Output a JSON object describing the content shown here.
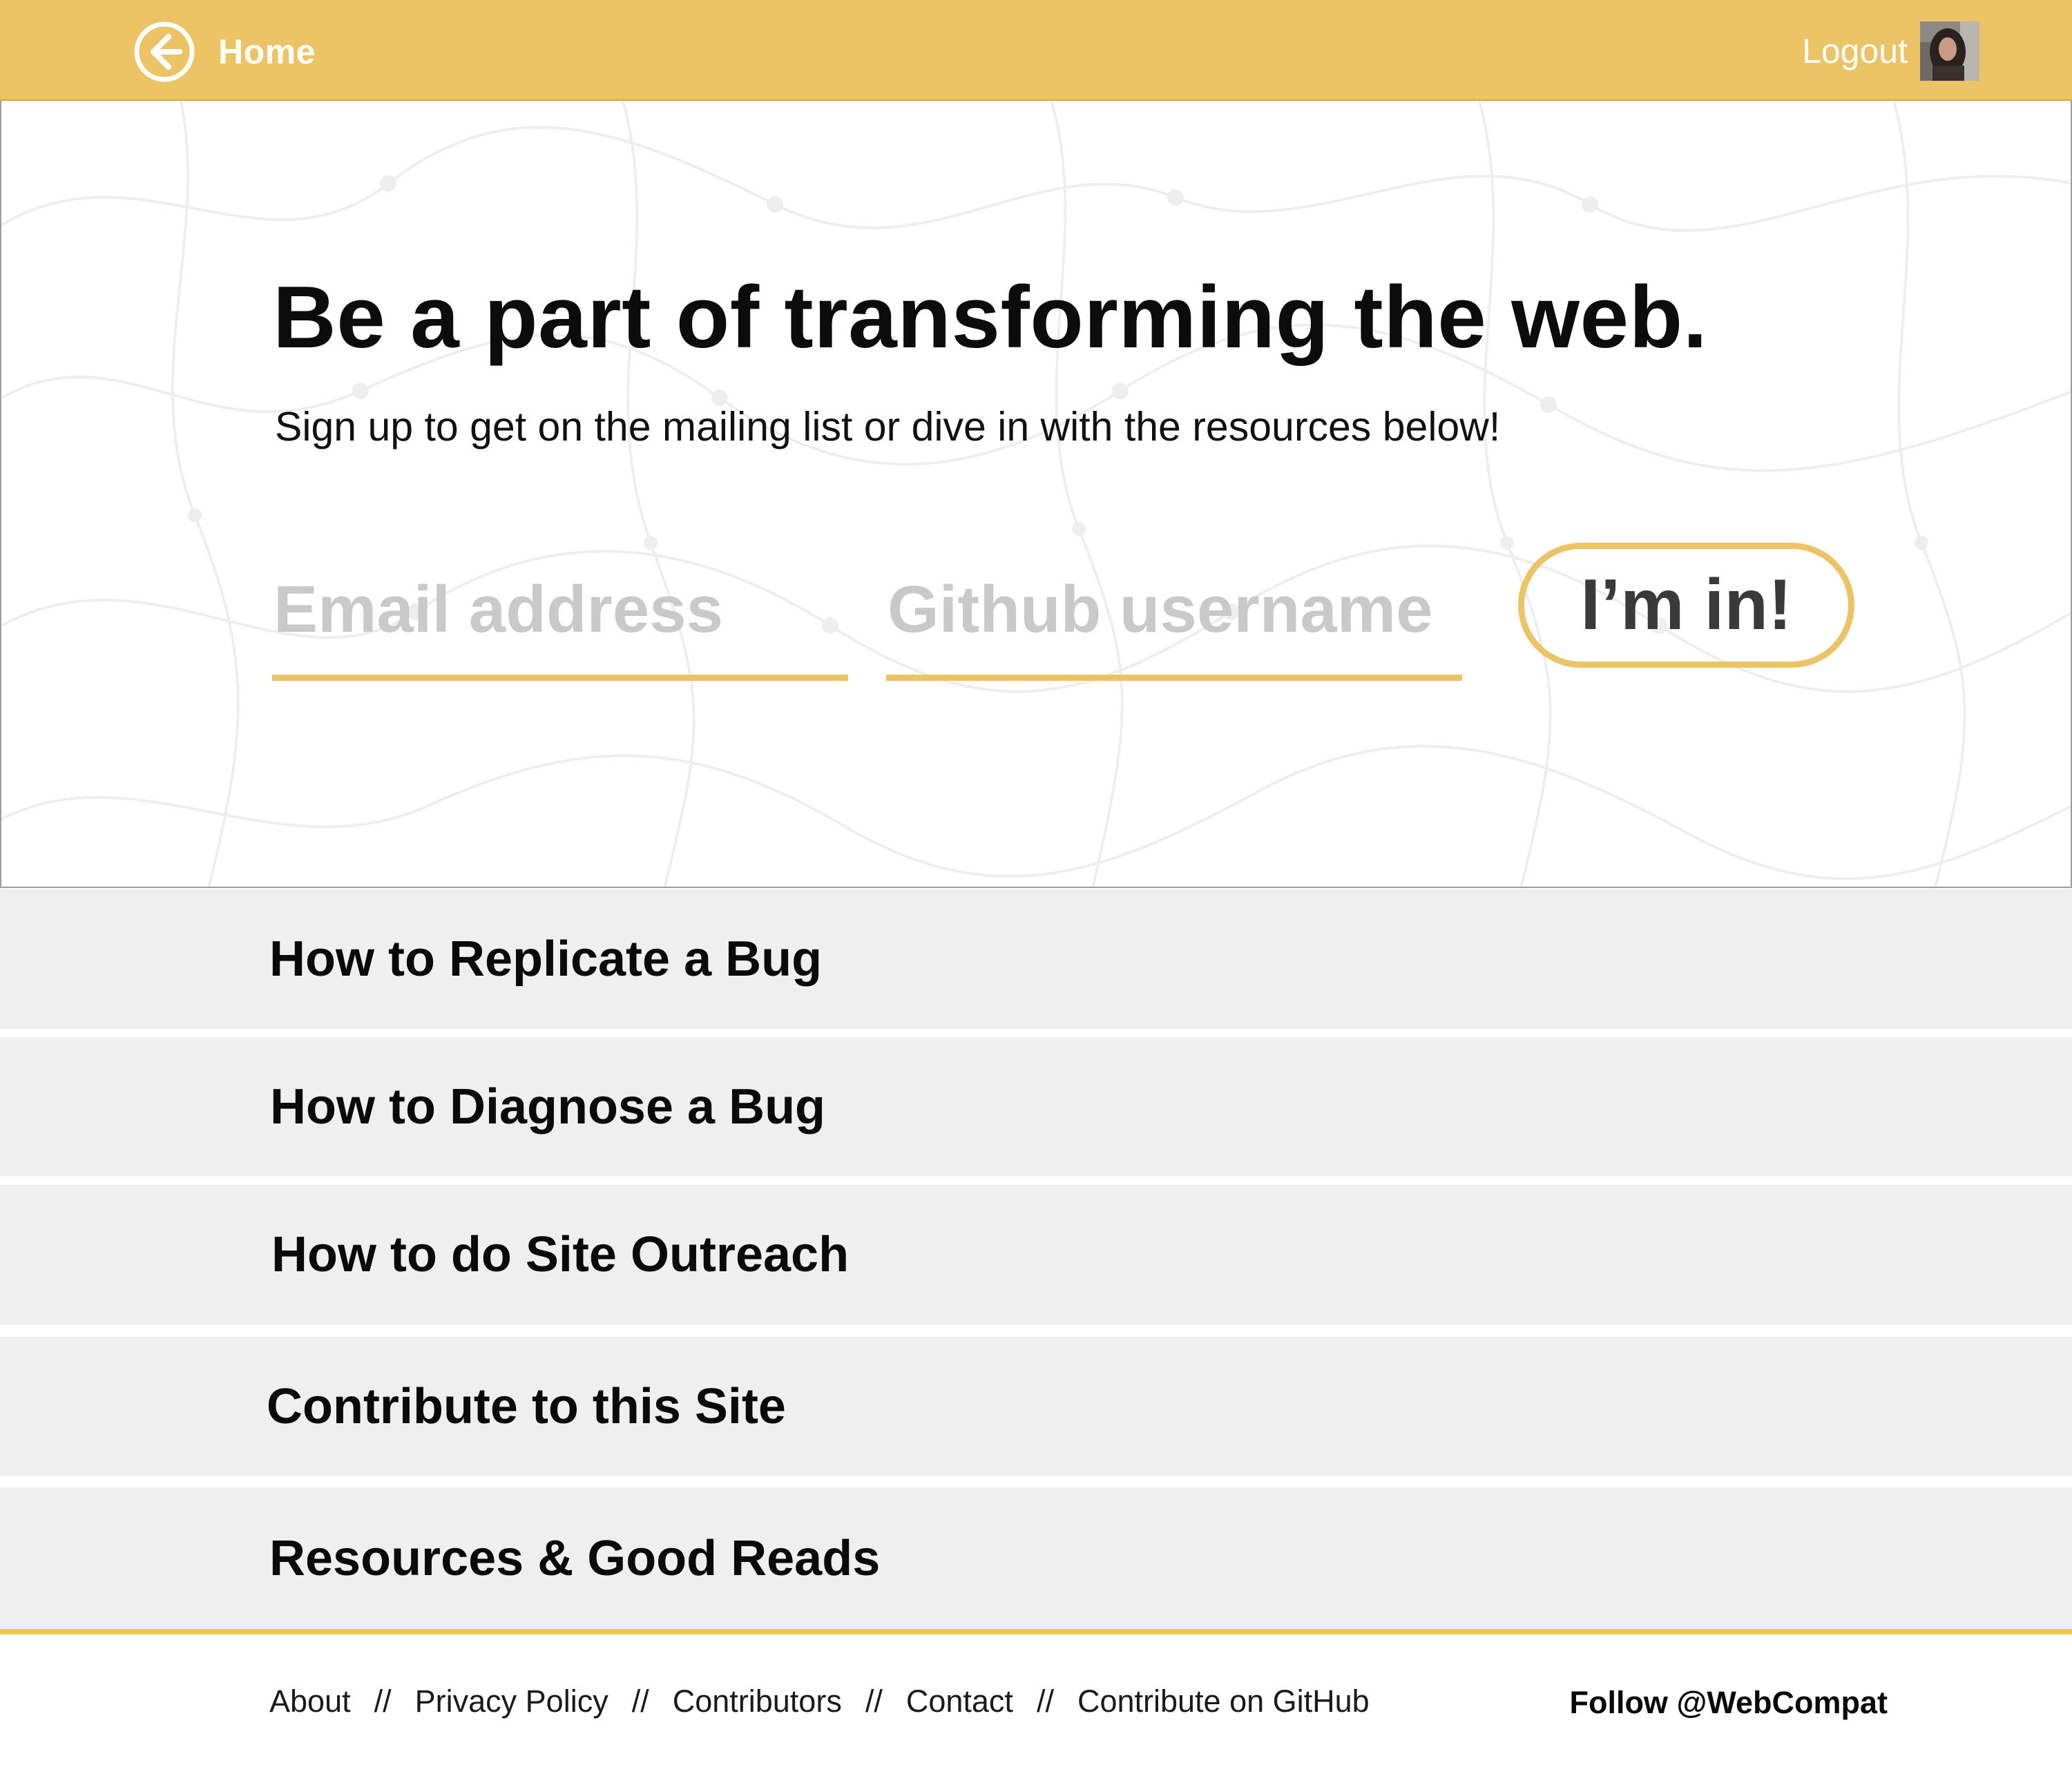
{
  "header": {
    "home_label": "Home",
    "logout_label": "Logout",
    "accent_color": "#ecc465"
  },
  "hero": {
    "title": "Be a part of transforming the web.",
    "subtitle": "Sign up to get on the mailing list or dive in with the resources below!",
    "email_placeholder": "Email address",
    "github_placeholder": "Github username",
    "submit_label": "I’m in!"
  },
  "resources": [
    {
      "label": "How to Replicate a Bug"
    },
    {
      "label": "How to Diagnose a Bug"
    },
    {
      "label": "How to do Site Outreach"
    },
    {
      "label": "Contribute to this Site"
    },
    {
      "label": "Resources & Good Reads"
    }
  ],
  "footer": {
    "links": [
      "About",
      "Privacy Policy",
      "Contributors",
      "Contact",
      "Contribute on GitHub"
    ],
    "separator": "//",
    "follow_label": "Follow @WebCompat"
  }
}
